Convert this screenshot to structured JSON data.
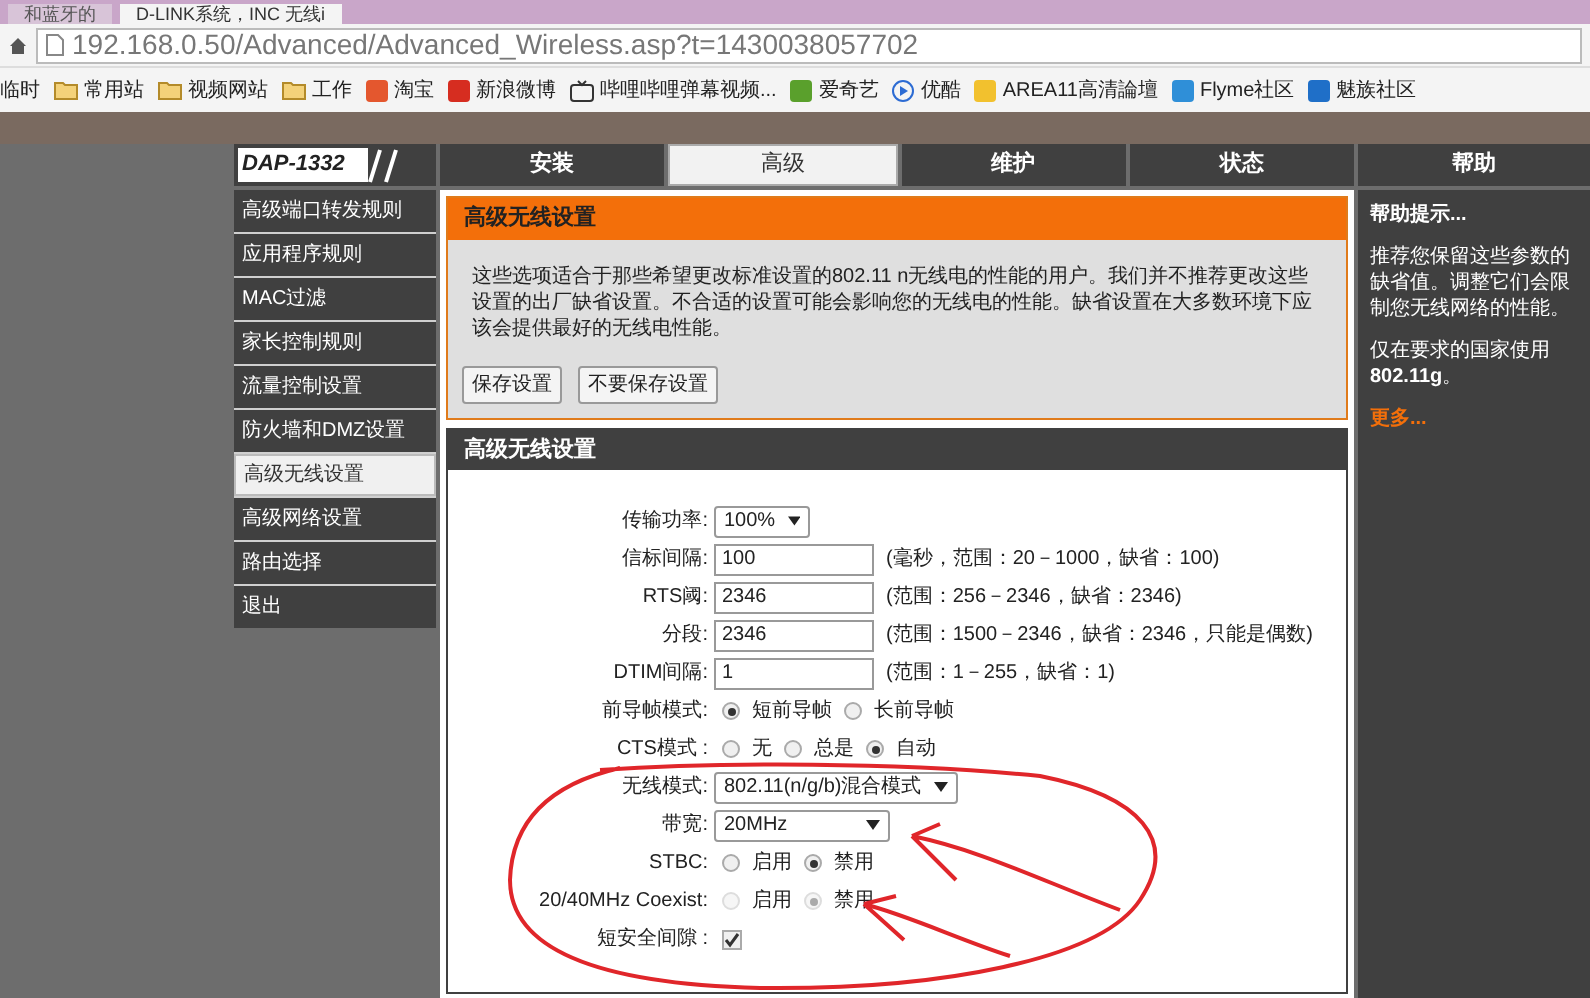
{
  "browser": {
    "tabs": [
      {
        "title": "和蓝牙的",
        "selected": false
      },
      {
        "title": "D-LINK系统，INC 无线i",
        "selected": true
      }
    ],
    "address": "192.168.0.50/Advanced/Advanced_Wireless.asp?t=1430038057702",
    "bookmarks": [
      {
        "label": "临时",
        "kind": "plain"
      },
      {
        "label": "常用站",
        "kind": "folder"
      },
      {
        "label": "视频网站",
        "kind": "folder"
      },
      {
        "label": "工作",
        "kind": "folder"
      },
      {
        "label": "淘宝",
        "kind": "site",
        "color": "#e4572e"
      },
      {
        "label": "新浪微博",
        "kind": "site",
        "color": "#d62d20"
      },
      {
        "label": "哔哩哔哩弹幕视频...",
        "kind": "tv"
      },
      {
        "label": "爱奇艺",
        "kind": "site",
        "color": "#5aa02c"
      },
      {
        "label": "优酷",
        "kind": "play"
      },
      {
        "label": "AREA11高清論壇",
        "kind": "site",
        "color": "#f2c12e"
      },
      {
        "label": "Flyme社区",
        "kind": "site",
        "color": "#2f8fd8"
      },
      {
        "label": "魅族社区",
        "kind": "site",
        "color": "#1f6fc8"
      }
    ]
  },
  "logo": "DAP-1332",
  "tabs": [
    {
      "label": "安装",
      "selected": false
    },
    {
      "label": "高级",
      "selected": true
    },
    {
      "label": "维护",
      "selected": false
    },
    {
      "label": "状态",
      "selected": false
    }
  ],
  "help_tab": "帮助",
  "sidebar": {
    "items": [
      {
        "label": "高级端口转发规则",
        "selected": false
      },
      {
        "label": "应用程序规则",
        "selected": false
      },
      {
        "label": "MAC过滤",
        "selected": false
      },
      {
        "label": "家长控制规则",
        "selected": false
      },
      {
        "label": "流量控制设置",
        "selected": false
      },
      {
        "label": "防火墙和DMZ设置",
        "selected": false
      },
      {
        "label": "高级无线设置",
        "selected": true
      },
      {
        "label": "高级网络设置",
        "selected": false
      },
      {
        "label": "路由选择",
        "selected": false
      },
      {
        "label": "退出",
        "selected": false
      }
    ]
  },
  "intro": {
    "title": "高级无线设置",
    "text": "这些选项适合于那些希望更改标准设置的802.11 n无线电的性能的用户。我们并不推荐更改这些设置的出厂缺省设置。不合适的设置可能会影响您的无线电的性能。缺省设置在大多数环境下应该会提供最好的无线电性能。",
    "buttons": [
      "保存设置",
      "不要保存设置"
    ]
  },
  "settings": {
    "title": "高级无线设置",
    "rows": [
      {
        "kind": "select",
        "label": "传输功率:",
        "value": "100%"
      },
      {
        "kind": "text",
        "label": "信标间隔:",
        "value": "100",
        "note": "(毫秒，范围：20－1000，缺省：100)"
      },
      {
        "kind": "text",
        "label": "RTS阈:",
        "value": "2346",
        "note": "(范围：256－2346，缺省：2346)"
      },
      {
        "kind": "text",
        "label": "分段:",
        "value": "2346",
        "note": "(范围：1500－2346，缺省：2346，只能是偶数)"
      },
      {
        "kind": "text",
        "label": "DTIM间隔:",
        "value": "1",
        "note": "(范围：1－255，缺省：1)"
      },
      {
        "kind": "radio",
        "label": "前导帧模式:",
        "options": [
          {
            "label": "短前导帧",
            "selected": true,
            "disabled": false
          },
          {
            "label": "长前导帧",
            "selected": false,
            "disabled": false
          }
        ]
      },
      {
        "kind": "radio",
        "label": "CTS模式 :",
        "options": [
          {
            "label": "无",
            "selected": false,
            "disabled": false
          },
          {
            "label": "总是",
            "selected": false,
            "disabled": false
          },
          {
            "label": "自动",
            "selected": true,
            "disabled": false
          }
        ]
      },
      {
        "kind": "select",
        "label": "无线模式:",
        "value": "802.11(n/g/b)混合模式"
      },
      {
        "kind": "select",
        "label": "带宽:",
        "value": "20MHz"
      },
      {
        "kind": "radio",
        "label": "STBC:",
        "options": [
          {
            "label": "启用",
            "selected": false,
            "disabled": false
          },
          {
            "label": "禁用",
            "selected": true,
            "disabled": false
          }
        ]
      },
      {
        "kind": "radio",
        "label": "20/40MHz Coexist:",
        "options": [
          {
            "label": "启用",
            "selected": false,
            "disabled": true
          },
          {
            "label": "禁用",
            "selected": true,
            "disabled": true
          }
        ]
      },
      {
        "kind": "checkbox",
        "label": "短安全间隙 :",
        "checked": true
      }
    ]
  },
  "help": {
    "title": "帮助提示...",
    "paragraphs": [
      "推荐您保留这些参数的缺省值。调整它们会限制您无线网络的性能。",
      "仅在要求的国家使用**802.11g**。"
    ],
    "more": "更多..."
  }
}
